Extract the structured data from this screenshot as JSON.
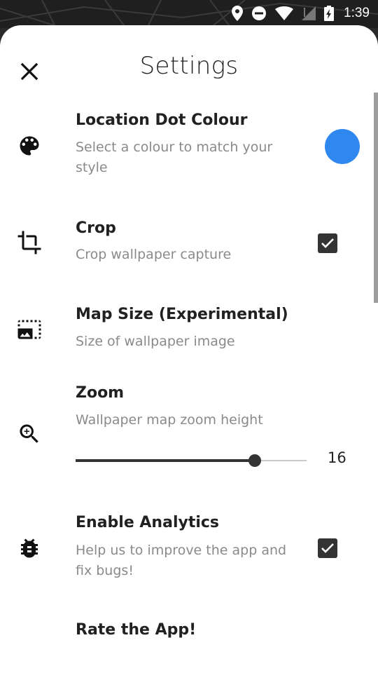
{
  "status": {
    "time": "1:39"
  },
  "header": {
    "title": "Settings"
  },
  "settings": {
    "location_dot": {
      "title": "Location Dot Colour",
      "subtitle": "Select a colour to match your style",
      "color": "#2f87f0"
    },
    "crop": {
      "title": "Crop",
      "subtitle": "Crop wallpaper capture",
      "checked": true
    },
    "map_size": {
      "title": "Map Size (Experimental)",
      "subtitle": "Size of wallpaper image"
    },
    "zoom": {
      "title": "Zoom",
      "subtitle": "Wallpaper map zoom height",
      "value": "16",
      "fraction": 0.776
    },
    "analytics": {
      "title": "Enable Analytics",
      "subtitle": "Help us to improve the app and fix bugs!",
      "checked": true
    },
    "rate": {
      "title": "Rate the App!"
    }
  },
  "icons": {
    "close": "close-icon",
    "palette": "palette-icon",
    "crop": "crop-icon",
    "map_size": "photo-size-select-icon",
    "zoom": "zoom-in-icon",
    "analytics": "bug-icon"
  }
}
